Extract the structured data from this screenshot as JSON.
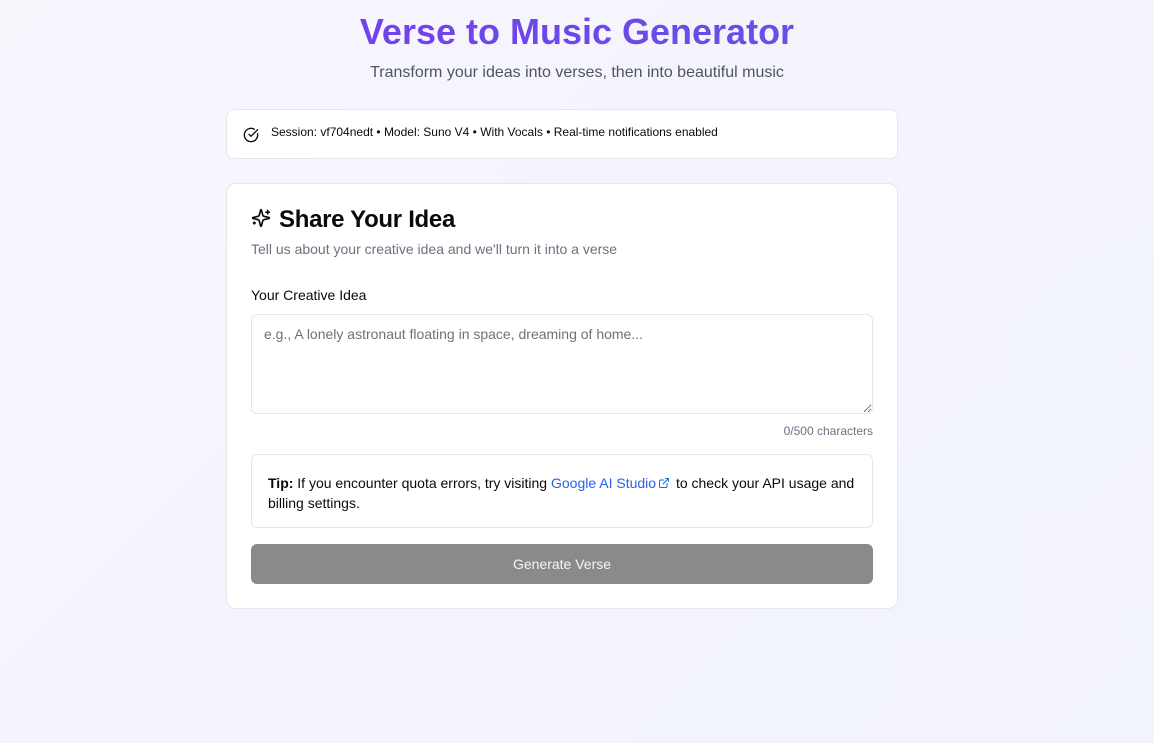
{
  "header": {
    "title": "Verse to Music Generator",
    "subtitle": "Transform your ideas into verses, then into beautiful music"
  },
  "session": {
    "icon": "check-circle-icon",
    "text": "Session: vf704nedt • Model: Suno V4 • With Vocals • Real-time notifications enabled"
  },
  "idea_card": {
    "icon": "sparkles-icon",
    "title": "Share Your Idea",
    "description": "Tell us about your creative idea and we'll turn it into a verse",
    "field_label": "Your Creative Idea",
    "textarea_value": "",
    "textarea_placeholder": "e.g., A lonely astronaut floating in space, dreaming of home...",
    "char_count": "0/500 characters",
    "tip": {
      "label": "Tip:",
      "text_before": " If you encounter quota errors, try visiting ",
      "link_text": "Google AI Studio",
      "link_icon": "external-link-icon",
      "text_after": " to check your API usage and billing settings."
    },
    "generate_button_label": "Generate Verse",
    "generate_button_disabled": true
  },
  "colors": {
    "title_gradient_start": "#7c3aed",
    "title_gradient_end": "#5b5fe3",
    "link": "#2563eb",
    "button_disabled": "#8a8a8a"
  }
}
